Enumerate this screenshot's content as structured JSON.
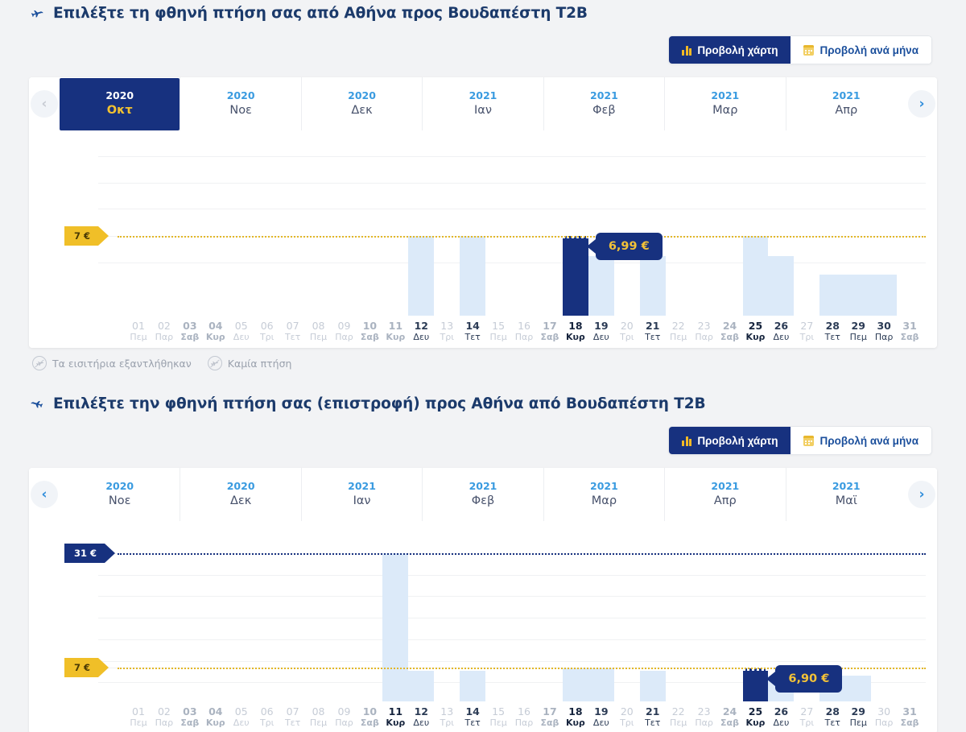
{
  "outbound": {
    "title": "Επιλέξτε τη φθηνή πτήση σας από Αθήνα προς Βουδαπέστη T2B",
    "plane_icon": "plane-depart-icon",
    "toggle": {
      "chart_label": "Προβολή χάρτη",
      "month_label": "Προβολή ανά μήνα",
      "chart_icon": "bar-chart-icon",
      "month_icon": "calendar-icon",
      "active": "chart"
    },
    "nav": {
      "prev_icon": "chevron-left-icon",
      "next_icon": "chevron-right-icon",
      "prev_enabled": false,
      "next_enabled": true
    },
    "months": [
      {
        "year": "2020",
        "month": "Οκτ",
        "active": true
      },
      {
        "year": "2020",
        "month": "Νοε",
        "active": false
      },
      {
        "year": "2020",
        "month": "Δεκ",
        "active": false
      },
      {
        "year": "2021",
        "month": "Ιαν",
        "active": false
      },
      {
        "year": "2021",
        "month": "Φεβ",
        "active": false
      },
      {
        "year": "2021",
        "month": "Μαρ",
        "active": false
      },
      {
        "year": "2021",
        "month": "Απρ",
        "active": false
      }
    ],
    "markers": [
      {
        "label": "7 €",
        "value": 7,
        "style": "yellow"
      }
    ],
    "tooltip": {
      "label": "6,99 €",
      "day": 18
    },
    "legend": [
      {
        "icon": "sold-out-icon",
        "label": "Τα εισιτήρια εξαντλήθηκαν"
      },
      {
        "icon": "no-flight-icon",
        "label": "Καμία πτήση"
      }
    ]
  },
  "inbound": {
    "title": "Επιλέξτε την φθηνή πτήση σας (επιστροφή) προς Αθήνα από Βουδαπέστη T2B",
    "plane_icon": "plane-arrive-icon",
    "toggle": {
      "chart_label": "Προβολή χάρτη",
      "month_label": "Προβολή ανά μήνα",
      "chart_icon": "bar-chart-icon",
      "month_icon": "calendar-icon",
      "active": "chart"
    },
    "nav": {
      "prev_icon": "chevron-left-icon",
      "next_icon": "chevron-right-icon",
      "prev_enabled": true,
      "next_enabled": true
    },
    "months": [
      {
        "year": "2020",
        "month": "Νοε",
        "active": false
      },
      {
        "year": "2020",
        "month": "Δεκ",
        "active": false
      },
      {
        "year": "2021",
        "month": "Ιαν",
        "active": false
      },
      {
        "year": "2021",
        "month": "Φεβ",
        "active": false
      },
      {
        "year": "2021",
        "month": "Μαρ",
        "active": false
      },
      {
        "year": "2021",
        "month": "Απρ",
        "active": false
      },
      {
        "year": "2021",
        "month": "Μαϊ",
        "active": false
      }
    ],
    "markers": [
      {
        "label": "31 €",
        "value": 31,
        "style": "navy"
      },
      {
        "label": "7 €",
        "value": 7,
        "style": "yellow"
      }
    ],
    "tooltip": {
      "label": "6,90 €",
      "day": 25
    }
  },
  "chart_data": [
    {
      "type": "bar",
      "title": "Επιλέξτε τη φθηνή πτήση σας από Αθήνα προς Βουδαπέστη T2B",
      "subtitle": "2020 Οκτ",
      "xlabel": "",
      "ylabel": "€",
      "ylim": [
        0,
        14
      ],
      "grid": true,
      "legend_position": "below",
      "reference_lines": [
        {
          "label": "7 €",
          "value": 7,
          "color": "#f0bf28",
          "style": "dotted"
        }
      ],
      "selected_index": 17,
      "selected_label": "6,99 €",
      "categories": [
        "01",
        "02",
        "03",
        "04",
        "05",
        "06",
        "07",
        "08",
        "09",
        "10",
        "11",
        "12",
        "13",
        "14",
        "15",
        "16",
        "17",
        "18",
        "19",
        "20",
        "21",
        "22",
        "23",
        "24",
        "25",
        "26",
        "27",
        "28",
        "29",
        "30",
        "31"
      ],
      "weekdays": [
        "Πεμ",
        "Παρ",
        "Σαβ",
        "Κυρ",
        "Δευ",
        "Τρι",
        "Τετ",
        "Πεμ",
        "Παρ",
        "Σαβ",
        "Κυρ",
        "Δευ",
        "Τρι",
        "Τετ",
        "Πεμ",
        "Παρ",
        "Σαβ",
        "Κυρ",
        "Δευ",
        "Τρι",
        "Τετ",
        "Πεμ",
        "Παρ",
        "Σαβ",
        "Κυρ",
        "Δευ",
        "Τρι",
        "Τετ",
        "Πεμ",
        "Παρ",
        "Σαβ"
      ],
      "values": [
        0,
        0,
        0,
        0,
        0,
        0,
        0,
        0,
        0,
        0,
        0,
        7,
        0,
        7,
        0,
        0,
        0,
        6.99,
        5.2,
        0,
        5.2,
        0,
        0,
        0,
        7,
        5.2,
        0,
        3.6,
        3.6,
        3.6,
        0
      ]
    },
    {
      "type": "bar",
      "title": "Επιλέξτε την φθηνή πτήση σας (επιστροφή) προς Αθήνα από Βουδαπέστη T2B",
      "subtitle": "2020 Νοε",
      "xlabel": "",
      "ylabel": "€",
      "ylim": [
        0,
        34
      ],
      "grid": true,
      "legend_position": "none",
      "reference_lines": [
        {
          "label": "31 €",
          "value": 31,
          "color": "#17317f",
          "style": "dotted"
        },
        {
          "label": "7 €",
          "value": 7,
          "color": "#f0bf28",
          "style": "dotted"
        }
      ],
      "selected_index": 24,
      "selected_label": "6,90 €",
      "categories": [
        "01",
        "02",
        "03",
        "04",
        "05",
        "06",
        "07",
        "08",
        "09",
        "10",
        "11",
        "12",
        "13",
        "14",
        "15",
        "16",
        "17",
        "18",
        "19",
        "20",
        "21",
        "22",
        "23",
        "24",
        "25",
        "26",
        "27",
        "28",
        "29",
        "30",
        "31"
      ],
      "weekdays": [
        "Πεμ",
        "Παρ",
        "Σαβ",
        "Κυρ",
        "Δευ",
        "Τρι",
        "Τετ",
        "Πεμ",
        "Παρ",
        "Σαβ",
        "Κυρ",
        "Δευ",
        "Τρι",
        "Τετ",
        "Πεμ",
        "Παρ",
        "Σαβ",
        "Κυρ",
        "Δευ",
        "Τρι",
        "Τετ",
        "Πεμ",
        "Παρ",
        "Σαβ",
        "Κυρ",
        "Δευ",
        "Τρι",
        "Τετ",
        "Πεμ",
        "Παρ",
        "Σαβ"
      ],
      "values": [
        0,
        0,
        0,
        0,
        0,
        0,
        0,
        0,
        0,
        0,
        31,
        6.4,
        0,
        6.4,
        0,
        0,
        0,
        6.9,
        6.9,
        0,
        6.4,
        0,
        0,
        0,
        6.9,
        5.4,
        0,
        5.4,
        5.4,
        0,
        0
      ]
    }
  ]
}
